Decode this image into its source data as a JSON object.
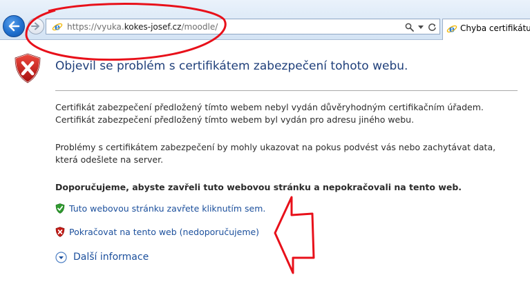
{
  "browser": {
    "url_prefix": "https://vyuka.",
    "url_domain": "kokes-josef.cz",
    "url_suffix": "/moodle/",
    "tab_title": "Chyba certifikátu: N"
  },
  "page": {
    "title": "Objevil se problém s certifikátem zabezpečení tohoto webu.",
    "paragraph1_line1": "Certifikát zabezpečení předložený tímto webem nebyl vydán důvěryhodným certifikačním úřadem.",
    "paragraph1_line2": "Certifikát zabezpečení předložený tímto webem byl vydán pro adresu jiného webu.",
    "paragraph2_line1": "Problémy s certifikátem zabezpečení by mohly ukazovat na pokus podvést vás nebo zachytávat data,",
    "paragraph2_line2": "která odešlete na server.",
    "recommendation": "Doporučujeme, abyste zavřeli tuto webovou stránku a nepokračovali na tento web.",
    "close_link": "Tuto webovou stránku zavřete kliknutím sem.",
    "continue_link": "Pokračovat na tento web (nedoporučujeme)",
    "more_info": "Další informace"
  },
  "icons": {
    "back": "back-arrow-icon",
    "forward": "forward-arrow-icon",
    "ie": "ie-logo-icon",
    "search": "search-icon",
    "dropdown": "dropdown-arrow-icon",
    "refresh": "refresh-icon",
    "shield_error": "shield-x-icon",
    "shield_ok": "shield-check-icon",
    "expand": "chevron-down-circle-icon"
  },
  "colors": {
    "title": "#1f3f7a",
    "link": "#1b4f9c",
    "annotation": "#e8101a",
    "shield_error": "#c41b16",
    "shield_ok": "#2f9a2f"
  }
}
